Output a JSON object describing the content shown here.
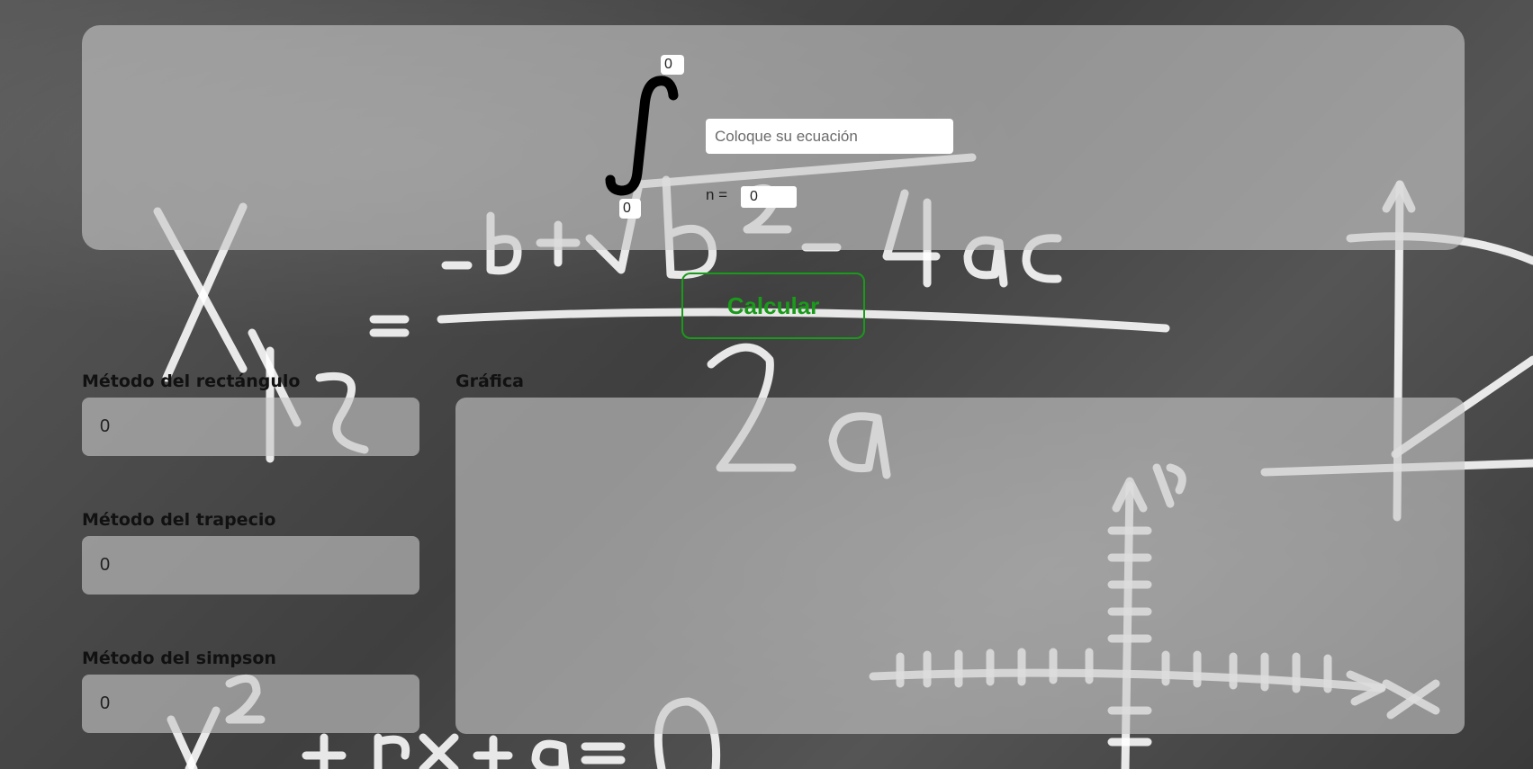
{
  "integral": {
    "upper_limit": "0",
    "lower_limit": "0",
    "equation_placeholder": "Coloque su ecuación",
    "n_label": "n =",
    "n_value": "0"
  },
  "actions": {
    "calculate_label": "Calcular"
  },
  "results": {
    "rectangle": {
      "label": "Método del rectángulo",
      "value": "0"
    },
    "trapezoid": {
      "label": "Método del trapecio",
      "value": "0"
    },
    "simpson": {
      "label": "Método del simpson",
      "value": "0"
    }
  },
  "chart": {
    "label": "Gráfica"
  },
  "colors": {
    "accent_green": "#1a9a1a",
    "panel_gray": "#c8c8c8",
    "chalkboard": "#4a4a4a"
  }
}
